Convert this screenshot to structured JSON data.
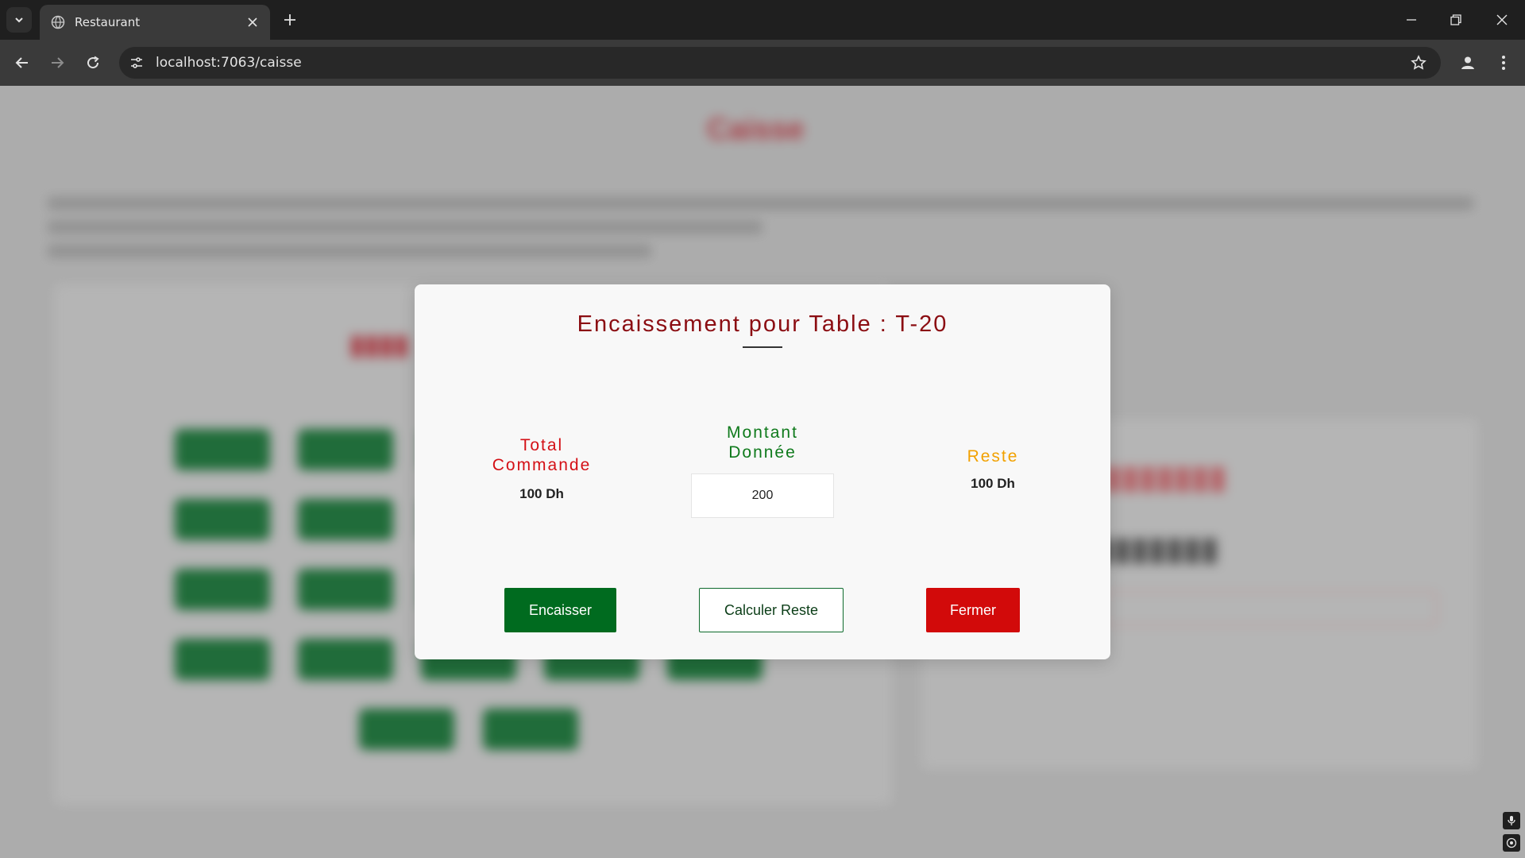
{
  "browser": {
    "tab_title": "Restaurant",
    "url": "localhost:7063/caisse"
  },
  "background_page": {
    "title": "Caisse"
  },
  "modal": {
    "title": "Encaissement pour Table : T-20",
    "total": {
      "label_line1": "Total",
      "label_line2": "Commande",
      "value": "100 Dh"
    },
    "montant": {
      "label_line1": "Montant",
      "label_line2": "Donnée",
      "input_value": "200"
    },
    "reste": {
      "label": "Reste",
      "value": "100 Dh"
    },
    "buttons": {
      "encaisser": "Encaisser",
      "calculer": "Calculer Reste",
      "fermer": "Fermer"
    }
  },
  "colors": {
    "title": "#8b0d12",
    "total_label": "#d41016",
    "montant_label": "#0f7a1c",
    "reste_label": "#f2a100",
    "encaisser_bg": "#006b1f",
    "fermer_bg": "#d20a0a"
  },
  "icons": {
    "tab_list": "chevron-down-icon",
    "favicon": "globe-icon",
    "tab_close": "close-icon",
    "new_tab": "plus-icon",
    "minimize": "minimize-icon",
    "restore": "restore-icon",
    "close": "close-icon",
    "back": "arrow-left-icon",
    "forward": "arrow-right-icon",
    "reload": "reload-icon",
    "site_info": "tune-icon",
    "bookmark": "star-icon",
    "profile": "account-icon",
    "menu": "more-vert-icon",
    "mic": "mic-icon",
    "settings": "target-icon"
  }
}
